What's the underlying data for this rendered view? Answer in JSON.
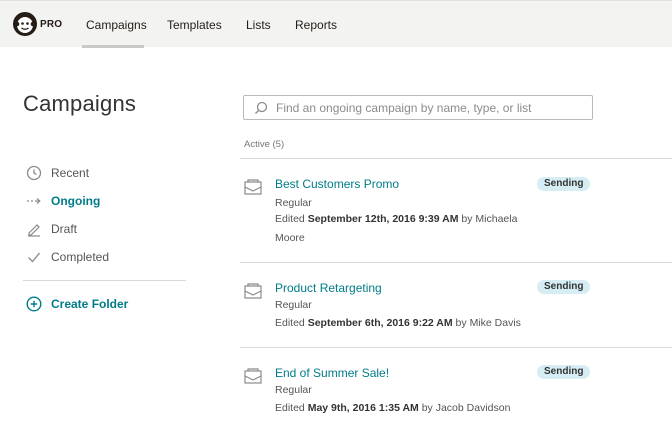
{
  "nav": {
    "brand_badge": "PRO",
    "links": [
      {
        "label": "Campaigns",
        "active": true
      },
      {
        "label": "Templates",
        "active": false
      },
      {
        "label": "Lists",
        "active": false
      },
      {
        "label": "Reports",
        "active": false
      }
    ]
  },
  "sidebar": {
    "title": "Campaigns",
    "items": [
      {
        "label": "Recent",
        "icon": "clock-icon",
        "active": false
      },
      {
        "label": "Ongoing",
        "icon": "arrow-right-icon",
        "active": true
      },
      {
        "label": "Draft",
        "icon": "pencil-icon",
        "active": false
      },
      {
        "label": "Completed",
        "icon": "check-icon",
        "active": false
      }
    ],
    "create_folder": "Create Folder"
  },
  "search": {
    "placeholder": "Find an ongoing campaign by name, type, or list"
  },
  "list": {
    "section_label": "Active (5)",
    "campaigns": [
      {
        "title": "Best Customers Promo",
        "type": "Regular",
        "edited_prefix": "Edited",
        "edited_date": "September 12th, 2016 9:39 AM",
        "by_prefix": "by",
        "author": "Michaela Moore",
        "status": "Sending"
      },
      {
        "title": "Product Retargeting",
        "type": "Regular",
        "edited_prefix": "Edited",
        "edited_date": "September 6th, 2016 9:22 AM",
        "by_prefix": "by",
        "author": "Mike Davis",
        "status": "Sending"
      },
      {
        "title": "End of Summer Sale!",
        "type": "Regular",
        "edited_prefix": "Edited",
        "edited_date": "May 9th, 2016 1:35 AM",
        "by_prefix": "by",
        "author": "Jacob Davidson",
        "status": "Sending"
      }
    ]
  },
  "colors": {
    "accent": "#007c89",
    "badge_bg": "#d6eef3",
    "nav_bg": "#f3f3f2"
  }
}
